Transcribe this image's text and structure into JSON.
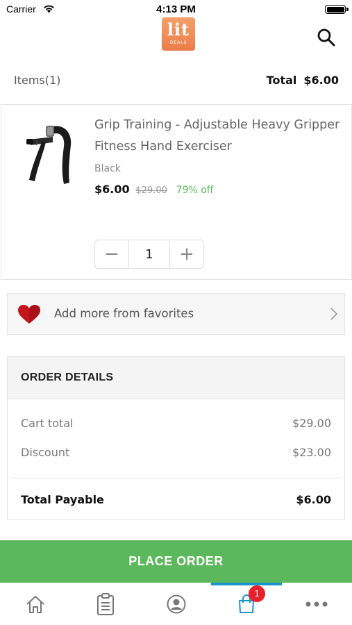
{
  "status_bar": {
    "carrier": "Carrier",
    "time": "4:13 PM"
  },
  "header": {
    "logo_main": "lit",
    "logo_sub": "DEALS"
  },
  "cart_summary": {
    "items_label": "Items(1)",
    "total_label": "Total",
    "total_value": "$6.00"
  },
  "product": {
    "name": "Grip Training - Adjustable Heavy Gripper Fitness Hand Exerciser",
    "variant": "Black",
    "price": "$6.00",
    "original_price": "$29.00",
    "discount": "79% off",
    "quantity": "1",
    "minus_symbol": "−",
    "plus_symbol": "+"
  },
  "favorites": {
    "label": "Add more from favorites"
  },
  "order_details": {
    "title": "ORDER DETAILS",
    "cart_total_label": "Cart total",
    "cart_total_value": "$29.00",
    "discount_label": "Discount",
    "discount_value": "$23.00",
    "total_payable_label": "Total Payable",
    "total_payable_value": "$6.00"
  },
  "place_order": {
    "label": "PLACE ORDER"
  },
  "tab_bar": {
    "tabs": [
      {
        "icon": "home-icon"
      },
      {
        "icon": "orders-icon"
      },
      {
        "icon": "profile-icon"
      },
      {
        "icon": "cart-icon",
        "active": true,
        "badge": "1"
      },
      {
        "icon": "more-icon"
      }
    ]
  },
  "colors": {
    "green": "#5cb85c",
    "active_tab": "#1a95c9",
    "badge": "#e8202a",
    "logo": "#ec7d4a",
    "heart": "#c4161c"
  }
}
